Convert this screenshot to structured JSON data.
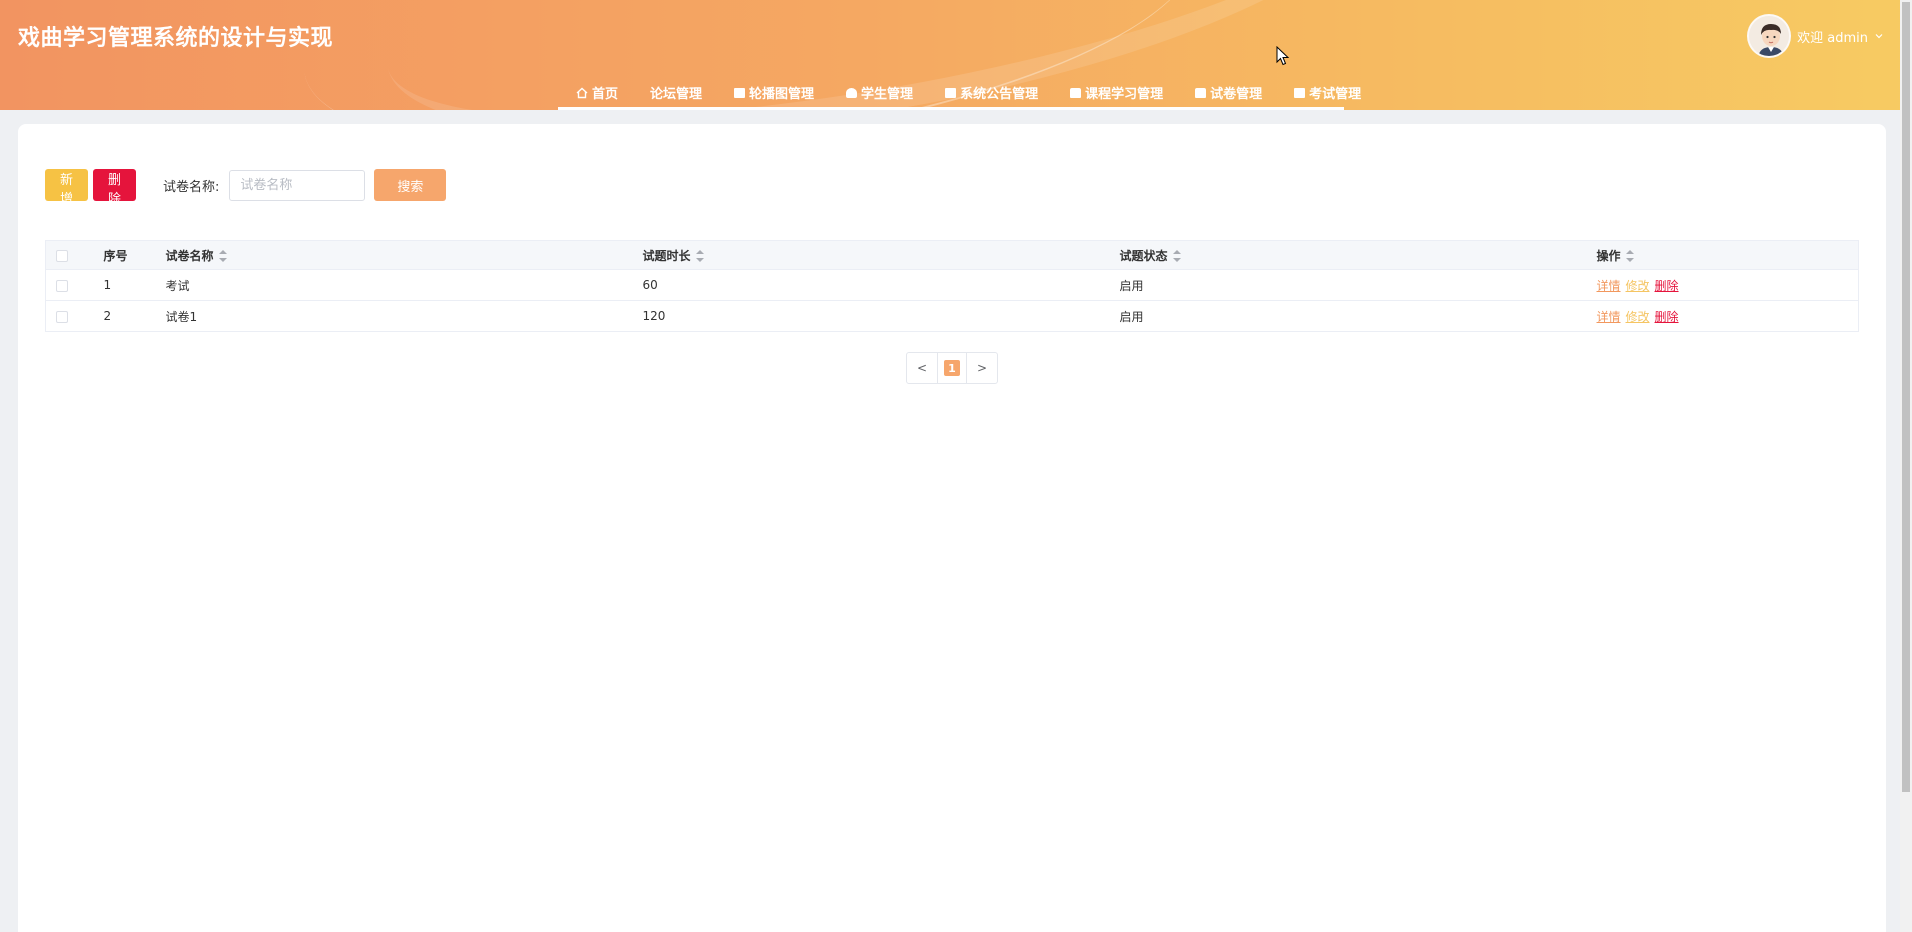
{
  "app": {
    "title": "戏曲学习管理系统的设计与实现",
    "welcome_label": "欢迎 admin"
  },
  "nav": {
    "items": [
      {
        "label": "首页",
        "icon": "home-icon"
      },
      {
        "label": "论坛管理",
        "icon": ""
      },
      {
        "label": "轮播图管理",
        "icon": "image-icon"
      },
      {
        "label": "学生管理",
        "icon": "user-icon"
      },
      {
        "label": "系统公告管理",
        "icon": "notice-icon"
      },
      {
        "label": "课程学习管理",
        "icon": "course-icon"
      },
      {
        "label": "试卷管理",
        "icon": "paper-icon"
      },
      {
        "label": "考试管理",
        "icon": "exam-icon"
      }
    ]
  },
  "toolbar": {
    "add_label": "新增",
    "delete_label": "删除",
    "search_label": "试卷名称:",
    "search_placeholder": "试卷名称",
    "search_value": "",
    "search_button": "搜索"
  },
  "table": {
    "headers": {
      "index": "序号",
      "name": "试卷名称",
      "duration": "试题时长",
      "status": "试题状态",
      "actions": "操作"
    },
    "rows": [
      {
        "index": "1",
        "name": "考试",
        "duration": "60",
        "status": "启用"
      },
      {
        "index": "2",
        "name": "试卷1",
        "duration": "120",
        "status": "启用"
      }
    ],
    "action_labels": {
      "detail": "详情",
      "edit": "修改",
      "delete": "删除"
    }
  },
  "pagination": {
    "prev": "<",
    "current": "1",
    "next": ">"
  },
  "colors": {
    "header_start": "#f29461",
    "header_end": "#f7cb62",
    "add_button": "#f6c244",
    "delete_button": "#e5143c",
    "search_button": "#f6a66c"
  }
}
